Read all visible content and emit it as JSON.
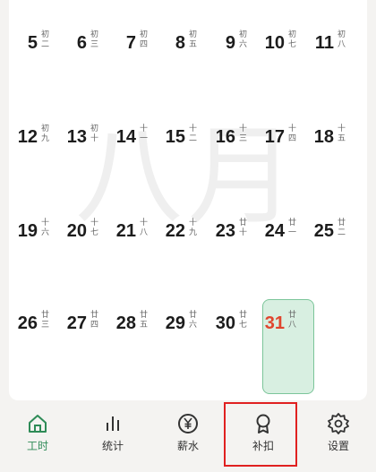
{
  "calendar": {
    "month_watermark": "八月",
    "days": [
      {
        "day": "5",
        "lunar": "初二"
      },
      {
        "day": "6",
        "lunar": "初三"
      },
      {
        "day": "7",
        "lunar": "初四"
      },
      {
        "day": "8",
        "lunar": "初五"
      },
      {
        "day": "9",
        "lunar": "初六"
      },
      {
        "day": "10",
        "lunar": "初七"
      },
      {
        "day": "11",
        "lunar": "初八"
      },
      {
        "day": "12",
        "lunar": "初九"
      },
      {
        "day": "13",
        "lunar": "初十"
      },
      {
        "day": "14",
        "lunar": "十一"
      },
      {
        "day": "15",
        "lunar": "十二"
      },
      {
        "day": "16",
        "lunar": "十三"
      },
      {
        "day": "17",
        "lunar": "十四"
      },
      {
        "day": "18",
        "lunar": "十五"
      },
      {
        "day": "19",
        "lunar": "十六"
      },
      {
        "day": "20",
        "lunar": "十七"
      },
      {
        "day": "21",
        "lunar": "十八"
      },
      {
        "day": "22",
        "lunar": "十九"
      },
      {
        "day": "23",
        "lunar": "廿十"
      },
      {
        "day": "24",
        "lunar": "廿一"
      },
      {
        "day": "25",
        "lunar": "廿二"
      },
      {
        "day": "26",
        "lunar": "廿三"
      },
      {
        "day": "27",
        "lunar": "廿四"
      },
      {
        "day": "28",
        "lunar": "廿五"
      },
      {
        "day": "29",
        "lunar": "廿六"
      },
      {
        "day": "30",
        "lunar": "廿七"
      },
      {
        "day": "31",
        "lunar": "廿八"
      }
    ],
    "today": "31",
    "today_color": "#e0452e",
    "today_bg": "#d8efe1"
  },
  "tabbar": {
    "items": [
      {
        "label": "工时",
        "icon": "home-icon",
        "active": true
      },
      {
        "label": "统计",
        "icon": "bar-chart-icon",
        "active": false
      },
      {
        "label": "薪水",
        "icon": "yen-coin-icon",
        "active": false
      },
      {
        "label": "补扣",
        "icon": "award-icon",
        "active": false
      },
      {
        "label": "设置",
        "icon": "gear-icon",
        "active": false
      }
    ],
    "active_color": "#2e8b57"
  },
  "highlight_target": "补扣"
}
